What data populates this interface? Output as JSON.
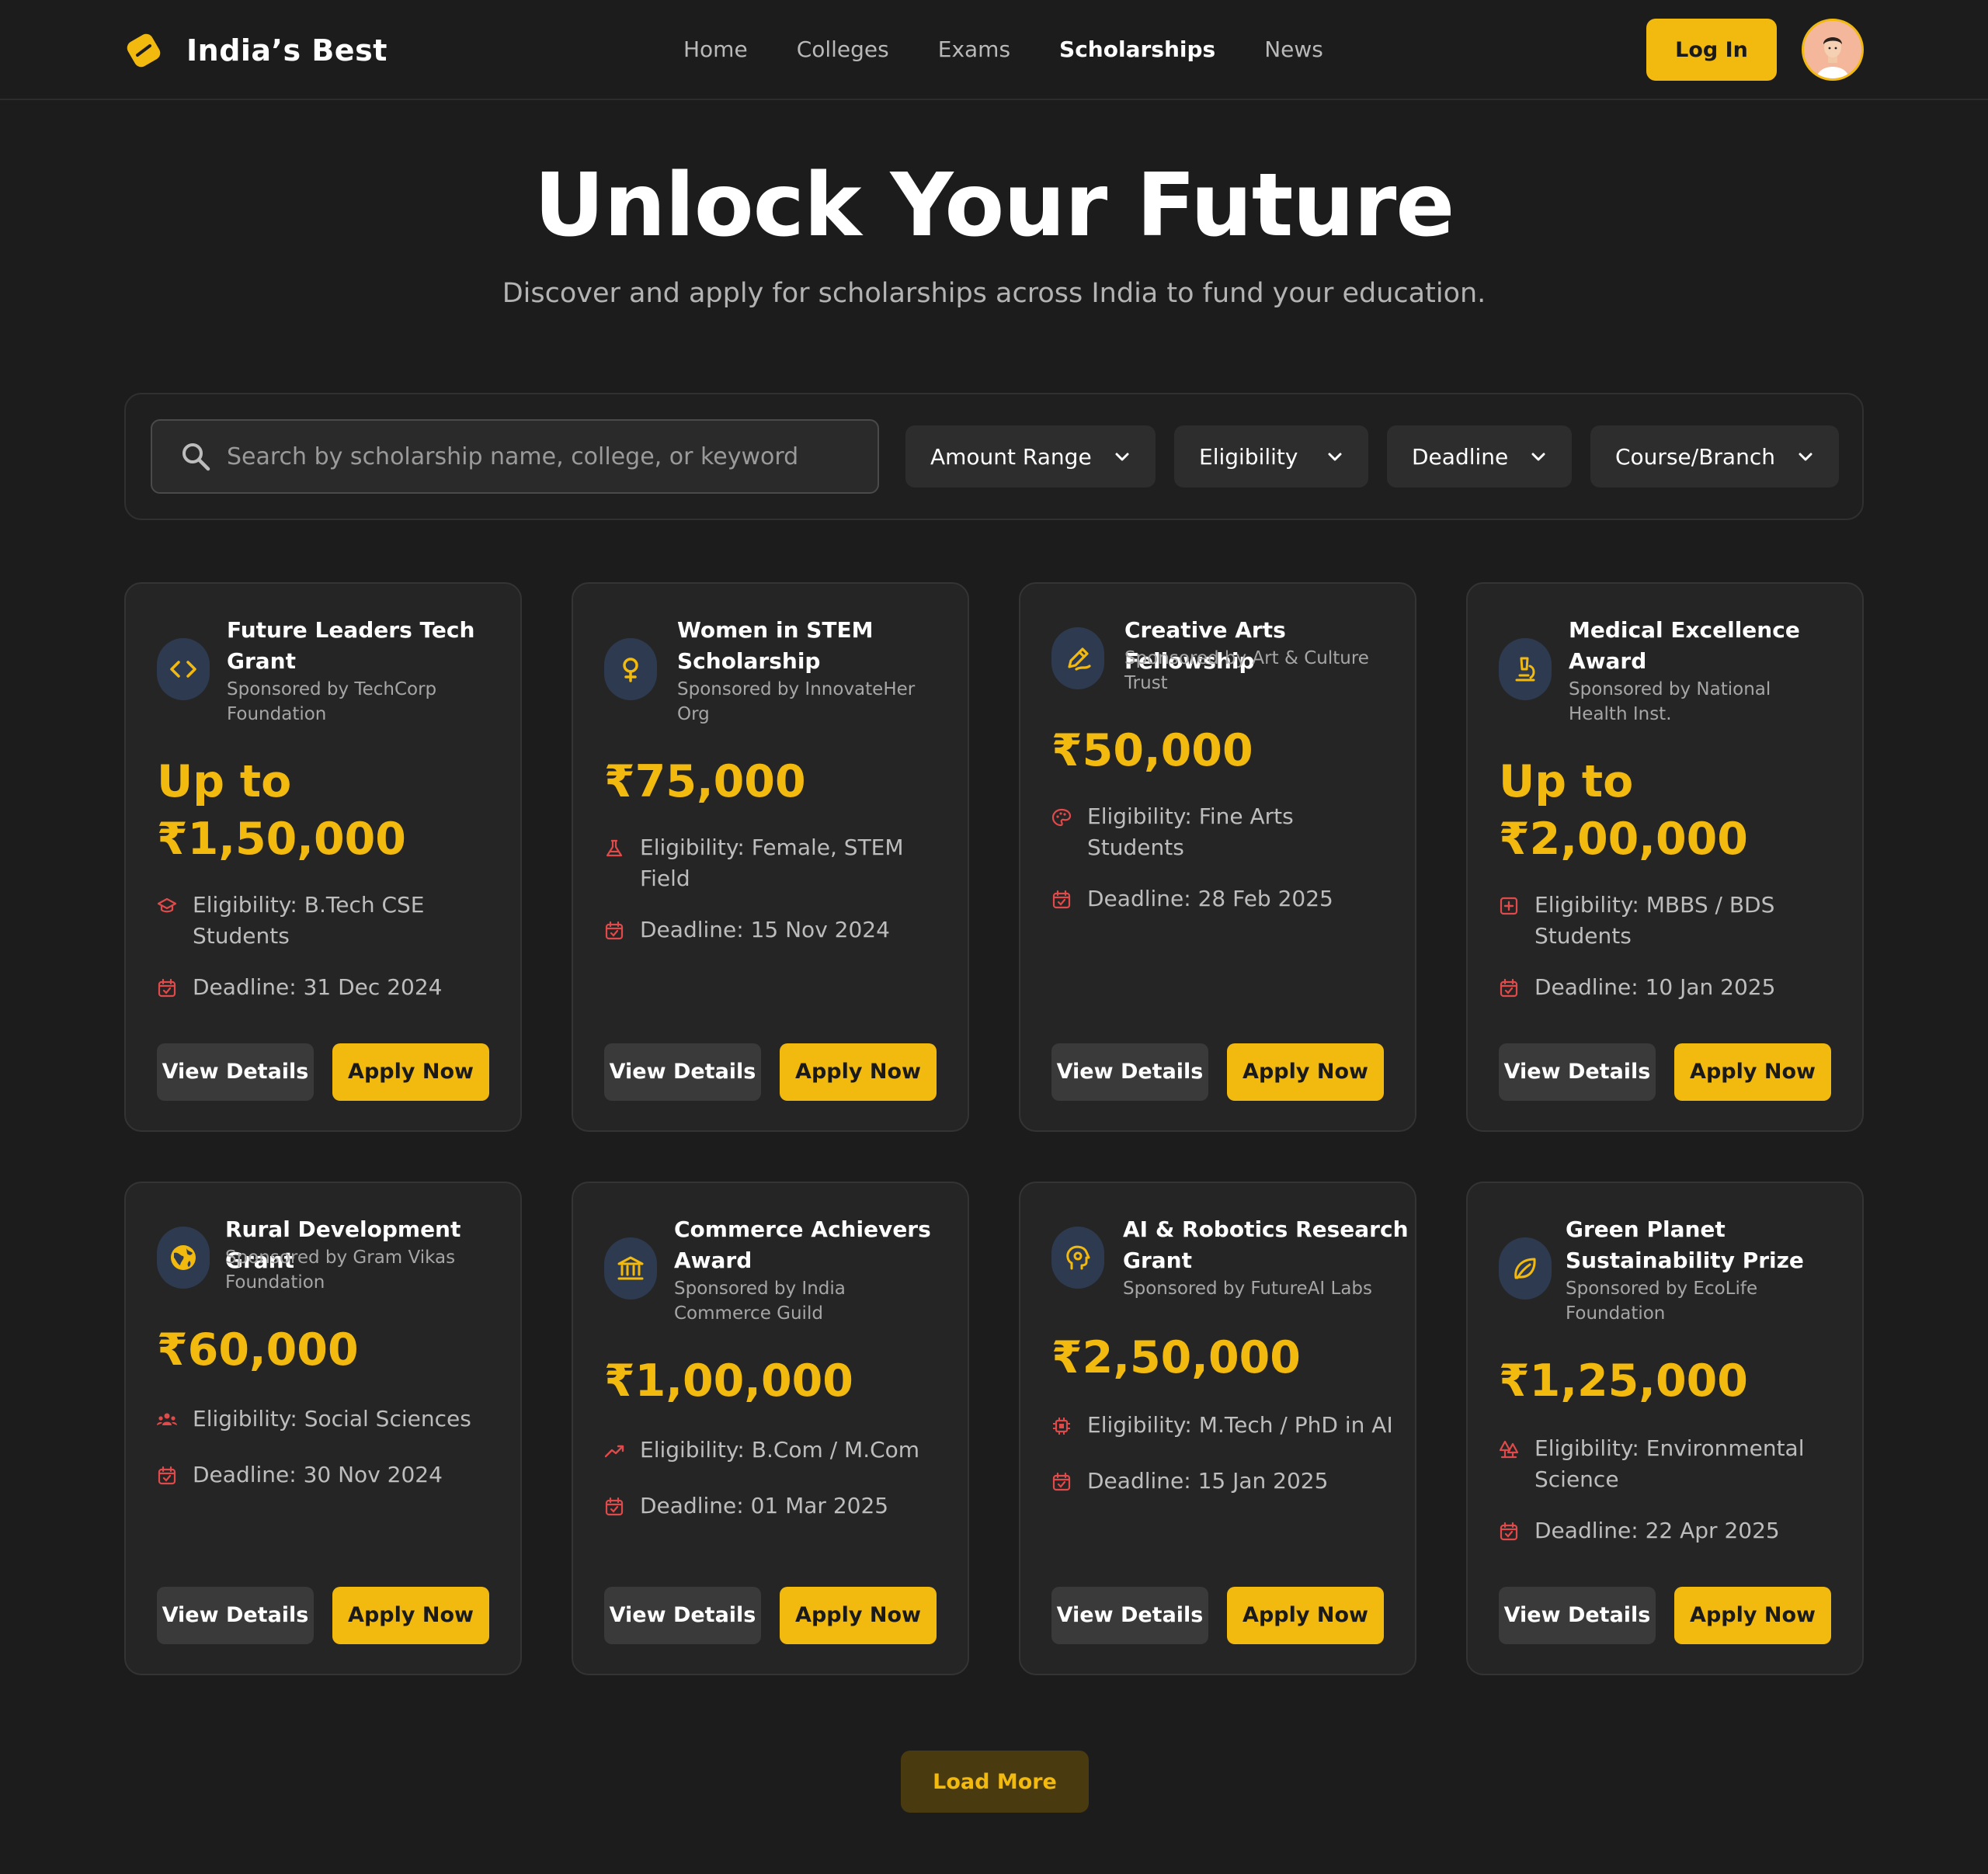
{
  "brand": {
    "name": "India’s Best",
    "accent": "#f2b90f"
  },
  "nav": {
    "home": "Home",
    "colleges": "Colleges",
    "exams": "Exams",
    "scholarships": "Scholarships",
    "news": "News"
  },
  "header": {
    "login_label": "Log In"
  },
  "hero": {
    "title": "Unlock Your Future",
    "subtitle": "Discover and apply for scholarships across India to fund your education."
  },
  "filters": {
    "search_placeholder": "Search by scholarship name, college, or keyword",
    "amount_range": "Amount Range",
    "eligibility": "Eligibility",
    "deadline": "Deadline",
    "course_branch": "Course/Branch"
  },
  "buttons": {
    "view_details": "View Details",
    "apply_now": "Apply Now",
    "load_more": "Load More"
  },
  "cards": [
    {
      "title": "Future Leaders Tech Grant",
      "sponsor": "Sponsored by TechCorp Foundation",
      "amount": "Up to ₹1,50,000",
      "eligibility": "Eligibility: B.Tech CSE Students",
      "deadline": "Deadline: 31 Dec 2024",
      "icon": "code-icon",
      "eligibility_icon": "graduation-cap-icon"
    },
    {
      "title": "Women in STEM Scholarship",
      "sponsor": "Sponsored by InnovateHer Org",
      "amount": "₹75,000",
      "eligibility": "Eligibility: Female, STEM Field",
      "deadline": "Deadline: 15 Nov 2024",
      "icon": "female-icon",
      "eligibility_icon": "flask-icon"
    },
    {
      "title": "Creative Arts Fellowship",
      "sponsor": "Sponsored by Art & Culture Trust",
      "amount": "₹50,000",
      "eligibility": "Eligibility: Fine Arts Students",
      "deadline": "Deadline: 28 Feb 2025",
      "icon": "draw-icon",
      "eligibility_icon": "palette-icon"
    },
    {
      "title": "Medical Excellence Award",
      "sponsor": "Sponsored by National Health Inst.",
      "amount": "Up to ₹2,00,000",
      "eligibility": "Eligibility: MBBS / BDS Students",
      "deadline": "Deadline: 10 Jan 2025",
      "icon": "microscope-icon",
      "eligibility_icon": "medical-cross-icon"
    },
    {
      "title": "Rural Development Grant",
      "sponsor": "Sponsored by Gram Vikas Foundation",
      "amount": "₹60,000",
      "eligibility": "Eligibility: Social Sciences",
      "deadline": "Deadline: 30 Nov 2024",
      "icon": "globe-icon",
      "eligibility_icon": "people-icon"
    },
    {
      "title": "Commerce Achievers Award",
      "sponsor": "Sponsored by India Commerce Guild",
      "amount": "₹1,00,000",
      "eligibility": "Eligibility: B.Com / M.Com",
      "deadline": "Deadline: 01 Mar 2025",
      "icon": "bank-icon",
      "eligibility_icon": "trending-up-icon"
    },
    {
      "title": "AI & Robotics Research Grant",
      "sponsor": "Sponsored by FutureAI Labs",
      "amount": "₹2,50,000",
      "eligibility": "Eligibility: M.Tech / PhD in AI",
      "deadline": "Deadline: 15 Jan 2025",
      "icon": "brain-gear-icon",
      "eligibility_icon": "chip-icon"
    },
    {
      "title": "Green Planet Sustainability Prize",
      "sponsor": "Sponsored by EcoLife Foundation",
      "amount": "₹1,25,000",
      "eligibility": "Eligibility: Environmental Science",
      "deadline": "Deadline: 22 Apr 2025",
      "icon": "leaf-icon",
      "eligibility_icon": "forest-icon"
    }
  ]
}
